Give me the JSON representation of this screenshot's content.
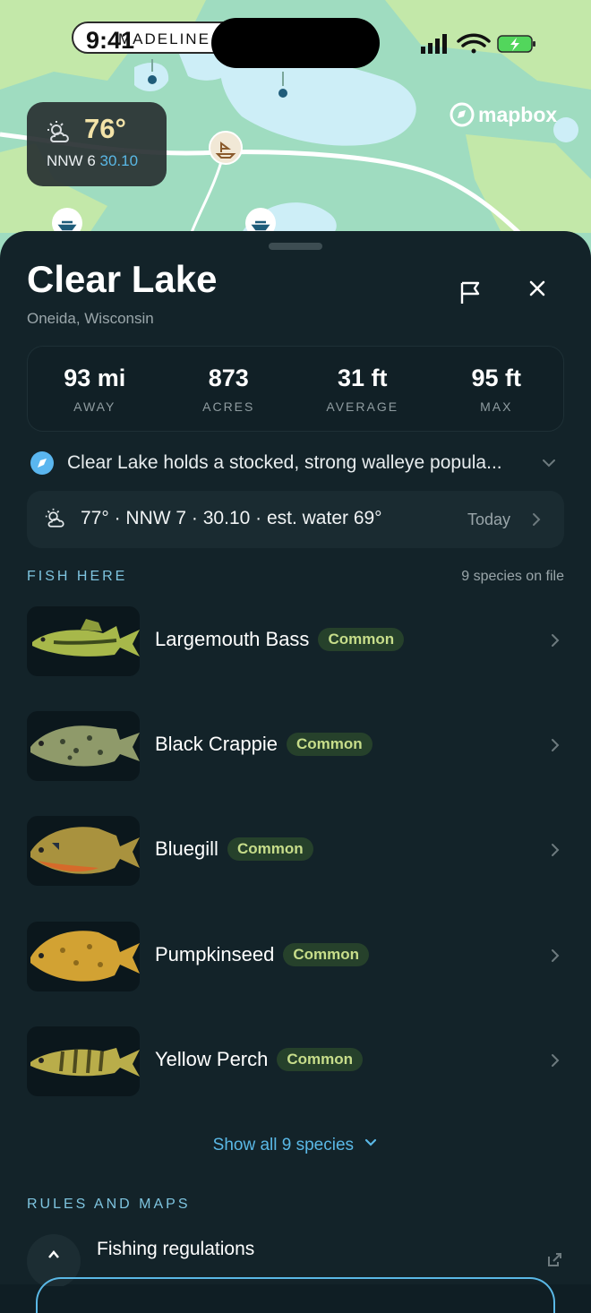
{
  "status_bar": {
    "time": "9:41"
  },
  "map": {
    "place_label": "MADELINE LAKE",
    "weather_chip": {
      "temp": "76°",
      "wind": "NNW 6",
      "pressure": "30.10",
      "icon": "partly-cloudy-icon"
    },
    "attribution": "mapbox",
    "colors": {
      "land": "#9fdcc0",
      "water": "#cdeef7",
      "forest": "#c3e8a9"
    }
  },
  "lake": {
    "name": "Clear Lake",
    "location": "Oneida, Wisconsin",
    "stats": [
      {
        "value": "93 mi",
        "label": "AWAY"
      },
      {
        "value": "873",
        "label": "ACRES"
      },
      {
        "value": "31 ft",
        "label": "AVERAGE"
      },
      {
        "value": "95 ft",
        "label": "MAX"
      }
    ],
    "summary": "Clear Lake holds a stocked, strong walleye popula...",
    "weather": {
      "text": "77° · NNW 7 · 30.10 · est. water 69°",
      "when": "Today"
    }
  },
  "fish_section": {
    "heading": "FISH HERE",
    "count_label": "9 species on file",
    "items": [
      {
        "name": "Largemouth Bass",
        "badge": "Common"
      },
      {
        "name": "Black Crappie",
        "badge": "Common"
      },
      {
        "name": "Bluegill",
        "badge": "Common"
      },
      {
        "name": "Pumpkinseed",
        "badge": "Common"
      },
      {
        "name": "Yellow Perch",
        "badge": "Common"
      }
    ],
    "show_all": "Show all 9 species"
  },
  "rules_section": {
    "heading": "RULES AND MAPS",
    "items": [
      {
        "label": "Fishing regulations"
      }
    ]
  },
  "colors": {
    "sheet": "#132329",
    "accent": "#5ab8e6",
    "badge_bg": "#26412b",
    "badge_text": "#c7dd8a"
  }
}
